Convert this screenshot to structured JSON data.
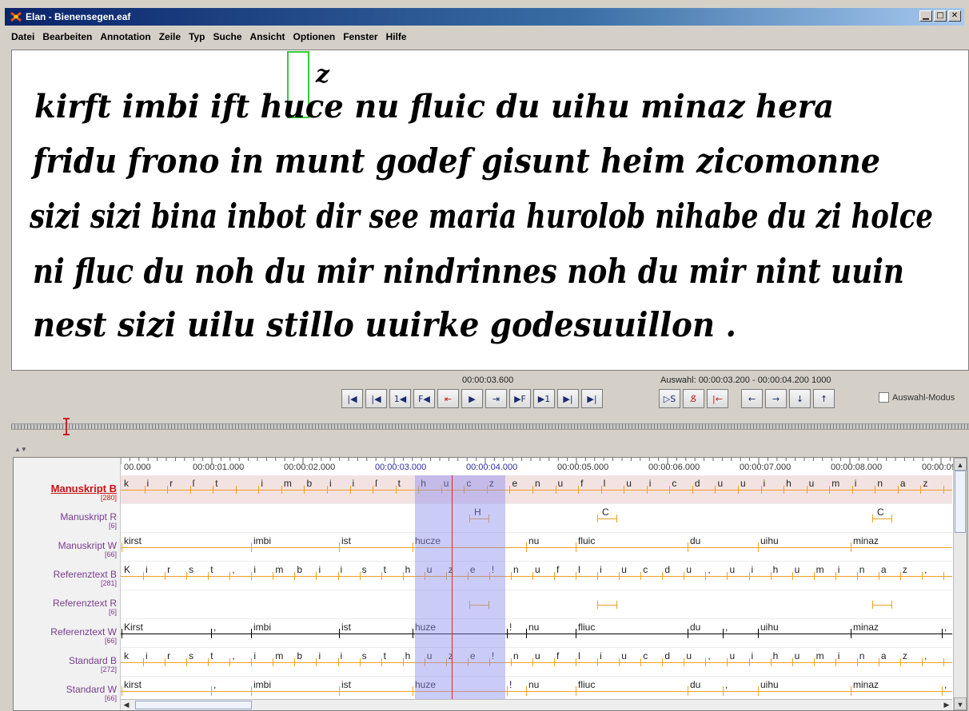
{
  "window": {
    "title": "Elan - Bienensegen.eaf",
    "min_glyph": "▁",
    "max_glyph": "□",
    "close_glyph": "✕"
  },
  "menu": [
    "Datei",
    "Bearbeiten",
    "Annotation",
    "Zeile",
    "Typ",
    "Suche",
    "Ansicht",
    "Optionen",
    "Fenster",
    "Hilfe"
  ],
  "manuscript": {
    "lines": [
      "kirft imbi ift huce nu fluic du uihu minaz hera",
      "fridu frono in munt godef gisunt heim zicomonne",
      "sizi sizi bina inbot dir see maria hurolob nihabe du zi holce",
      "ni fluc du noh du mir nindrinnes noh du mir nint uuin",
      "nest sizi uilu stillo uuirke godesuuillon ."
    ],
    "superscript": "z"
  },
  "media": {
    "current_time": "00:00:03.600",
    "selection": "Auswahl: 00:00:03.200 - 00:00:04.200  1000",
    "buttons_left": [
      "|◀",
      "|◀",
      "1◀",
      "F◀",
      "⇤",
      "▶",
      "⇥",
      "▶F",
      "▶1",
      "▶|",
      "▶|"
    ],
    "buttons_right": [
      "▷S",
      "S̸",
      "|←",
      "←",
      "→",
      "↓",
      "↑"
    ],
    "selection_mode_label": "Auswahl-Modus"
  },
  "ruler": {
    "labels": [
      "00.000",
      "00:00:01.000",
      "00:00:02.000",
      "00:00:03.000",
      "00:00:04.000",
      "00:00:05.000",
      "00:00:06.000",
      "00:00:07.000",
      "00:00:08.000",
      "00:00:09"
    ]
  },
  "tiers": [
    {
      "name": "Manuskript B",
      "count": "[280]",
      "active": true,
      "style": "chars",
      "annotations": [
        "k",
        "i",
        "r",
        "ſ",
        "t",
        "",
        "i",
        "m",
        "b",
        "i",
        "i",
        "ſ",
        "t",
        "h",
        "u",
        "c",
        "z",
        "e",
        "n",
        "u",
        "f",
        "l",
        "u",
        "i",
        "c",
        "d",
        "u",
        "u",
        "i",
        "h",
        "u",
        "m",
        "i",
        "n",
        "a",
        "z"
      ]
    },
    {
      "name": "Manuskript R",
      "count": "[6]",
      "active": false,
      "style": "sparse",
      "annotations": [
        "H",
        "C",
        "C"
      ]
    },
    {
      "name": "Manuskript W",
      "count": "[66]",
      "active": false,
      "style": "words",
      "annotations": [
        "kirst",
        "imbi",
        "ist",
        "hucze",
        "nu",
        "fluic",
        "du",
        "uihu",
        "minaz"
      ]
    },
    {
      "name": "Referenztext B",
      "count": "[281]",
      "active": false,
      "style": "chars",
      "annotations": [
        "K",
        "i",
        "r",
        "s",
        "t",
        ",",
        "i",
        "m",
        "b",
        "i",
        "i",
        "s",
        "t",
        "h",
        "u",
        "z",
        "e",
        "!",
        "n",
        "u",
        "f",
        "l",
        "i",
        "u",
        "c",
        "d",
        "u",
        ",",
        "u",
        "i",
        "h",
        "u",
        "m",
        "i",
        "n",
        "a",
        "z",
        ","
      ]
    },
    {
      "name": "Referenztext R",
      "count": "[6]",
      "active": false,
      "style": "sparse",
      "annotations": [
        "",
        "",
        ""
      ]
    },
    {
      "name": "Referenztext W",
      "count": "[66]",
      "active": false,
      "style": "words-black",
      "annotations": [
        "Kirst",
        ",",
        "imbi",
        "ist",
        "huze",
        "!",
        "nu",
        "fliuc",
        "du",
        ",",
        "uihu",
        "minaz",
        ","
      ]
    },
    {
      "name": "Standard B",
      "count": "[272]",
      "active": false,
      "style": "chars",
      "annotations": [
        "k",
        "i",
        "r",
        "s",
        "t",
        ",",
        "i",
        "m",
        "b",
        "i",
        "i",
        "s",
        "t",
        "h",
        "u",
        "z",
        "e",
        "!",
        "n",
        "u",
        "f",
        "l",
        "i",
        "u",
        "c",
        "d",
        "u",
        ",",
        "u",
        "i",
        "h",
        "u",
        "m",
        "i",
        "n",
        "a",
        "z",
        ","
      ]
    },
    {
      "name": "Standard W",
      "count": "[66]",
      "active": false,
      "style": "words",
      "annotations": [
        "kirst",
        ",",
        "imbi",
        "ist",
        "huze",
        "!",
        "nu",
        "fliuc",
        "du",
        ",",
        "uihu",
        "minaz",
        ","
      ]
    }
  ],
  "colors": {
    "tier_label": "#7a3b8f",
    "active_tier": "#cc1111",
    "annotation_line": "#f0a020",
    "selection": "#8c8cf0",
    "crosshair": "#ee2222"
  }
}
